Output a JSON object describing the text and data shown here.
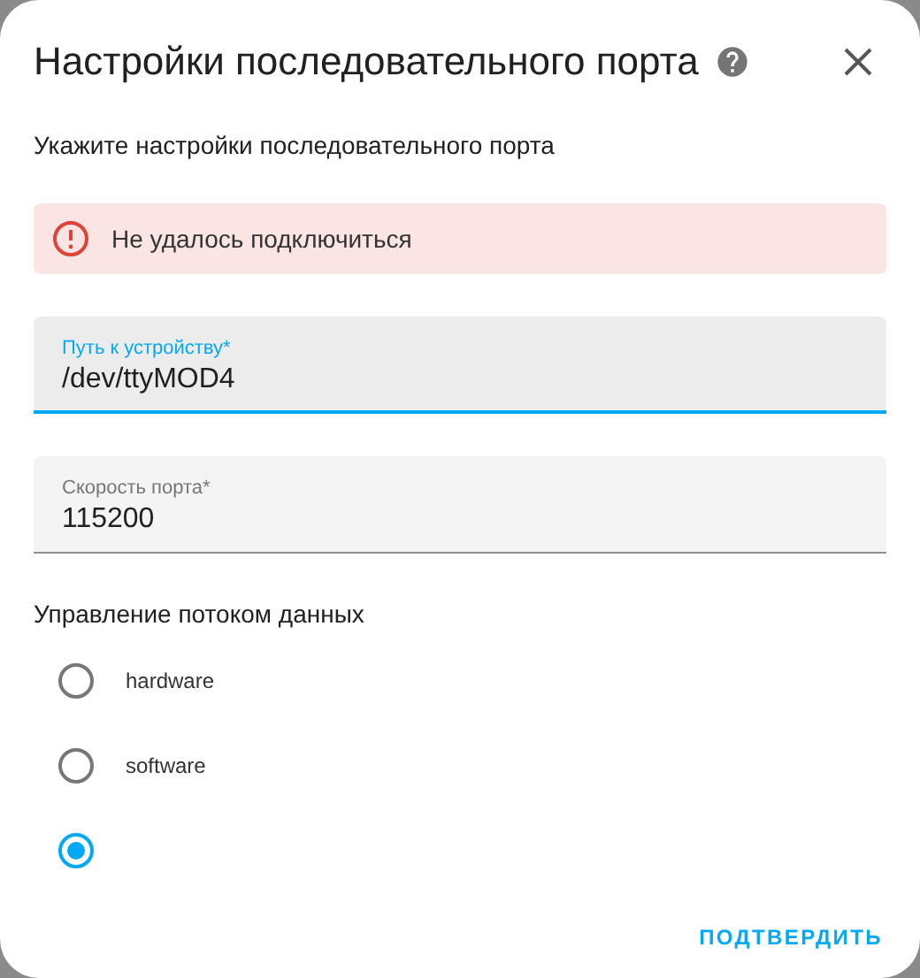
{
  "dialog": {
    "title": "Настройки последовательного порта",
    "subtitle": "Укажите настройки последовательного порта"
  },
  "error": {
    "message": "Не удалось подключиться"
  },
  "fields": [
    {
      "label": "Путь к устройству*",
      "value": "/dev/ttyMOD4",
      "focused": true
    },
    {
      "label": "Скорость порта*",
      "value": "115200",
      "focused": false
    }
  ],
  "flow_control": {
    "label": "Управление потоком данных",
    "options": [
      {
        "label": "hardware",
        "selected": false
      },
      {
        "label": "software",
        "selected": false
      },
      {
        "selected": true
      }
    ]
  },
  "buttons": [
    "ПОДТВЕРДИТЬ"
  ]
}
